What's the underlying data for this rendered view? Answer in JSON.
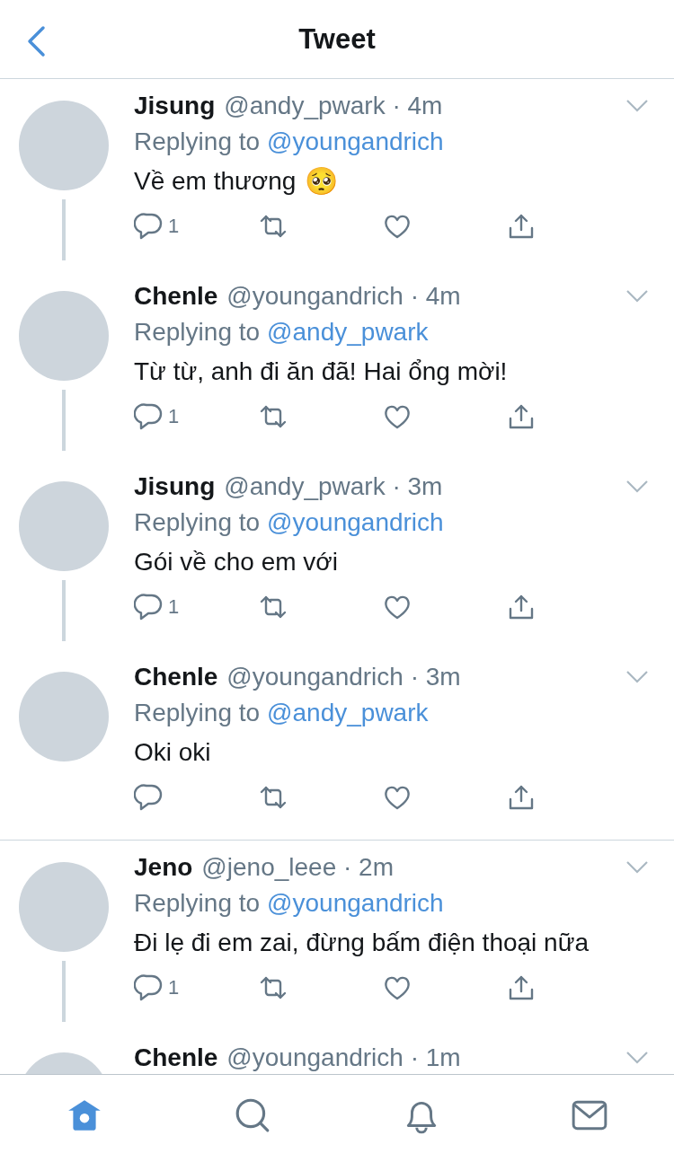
{
  "header": {
    "title": "Tweet"
  },
  "tweets": [
    {
      "name": "Jisung",
      "meta": "@andy_pwark · 4m",
      "replying_label": "Replying to",
      "replying_to": "@youngandrich",
      "text": "Về em thương",
      "emoji": "🥺",
      "reply_count": "1",
      "thread_line": true,
      "divider_after": false
    },
    {
      "name": "Chenle",
      "meta": "@youngandrich · 4m",
      "replying_label": "Replying to",
      "replying_to": "@andy_pwark",
      "text": "Từ từ, anh đi ăn đã! Hai ổng mời!",
      "reply_count": "1",
      "thread_line": true,
      "divider_after": false
    },
    {
      "name": "Jisung",
      "meta": "@andy_pwark · 3m",
      "replying_label": "Replying to",
      "replying_to": "@youngandrich",
      "text": "Gói về cho em với",
      "reply_count": "1",
      "thread_line": true,
      "divider_after": false
    },
    {
      "name": "Chenle",
      "meta": "@youngandrich · 3m",
      "replying_label": "Replying to",
      "replying_to": "@andy_pwark",
      "text": "Oki oki",
      "thread_line": false,
      "divider_after": true
    },
    {
      "name": "Jeno",
      "meta": "@jeno_leee · 2m",
      "replying_label": "Replying to",
      "replying_to": "@youngandrich",
      "text": "Đi lẹ đi em zai, đừng bấm điện thoại nữa",
      "reply_count": "1",
      "thread_line": true,
      "divider_after": false
    },
    {
      "name": "Chenle",
      "meta": "@youngandrich · 1m"
    }
  ],
  "tabbar": {
    "tabs": [
      {
        "kind": "home",
        "selected": true
      },
      {
        "kind": "search",
        "selected": false
      },
      {
        "kind": "notifications",
        "selected": false
      },
      {
        "kind": "messages",
        "selected": false
      }
    ]
  }
}
